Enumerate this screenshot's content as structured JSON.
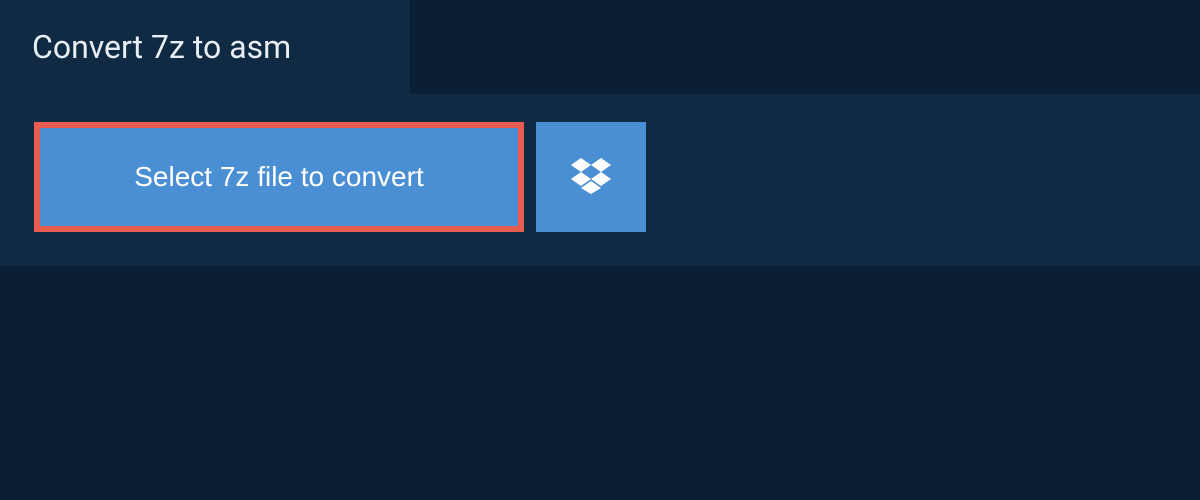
{
  "header": {
    "title": "Convert 7z to asm"
  },
  "actions": {
    "select_file_label": "Select 7z file to convert",
    "dropbox_icon_name": "dropbox-icon"
  },
  "colors": {
    "background": "#0a1f33",
    "panel": "#0f2a42",
    "button_primary": "#4a8fd4",
    "button_highlight_border": "#e85d4f",
    "text_light": "#e8eef4",
    "text_white": "#ffffff"
  }
}
